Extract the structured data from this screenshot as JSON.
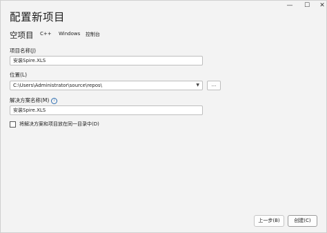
{
  "window": {
    "minimize": "—",
    "maximize": "☐",
    "close": "✕"
  },
  "header": {
    "title": "配置新项目",
    "project_type": "空项目",
    "tags": [
      "C++",
      "Windows",
      "控制台"
    ]
  },
  "form": {
    "project_name_label": "项目名称(J)",
    "project_name_value": "安装Spire.XLS",
    "location_label": "位置(L)",
    "location_value": "C:\\Users\\Administrator\\source\\repos\\",
    "browse_label": "...",
    "solution_name_label": "解决方案名称(M)",
    "solution_name_value": "安装Spire.XLS",
    "same_dir_label": "将解决方案和项目放在同一目录中(D)"
  },
  "footer": {
    "back_label": "上一步(B)",
    "create_label": "创建(C)"
  }
}
